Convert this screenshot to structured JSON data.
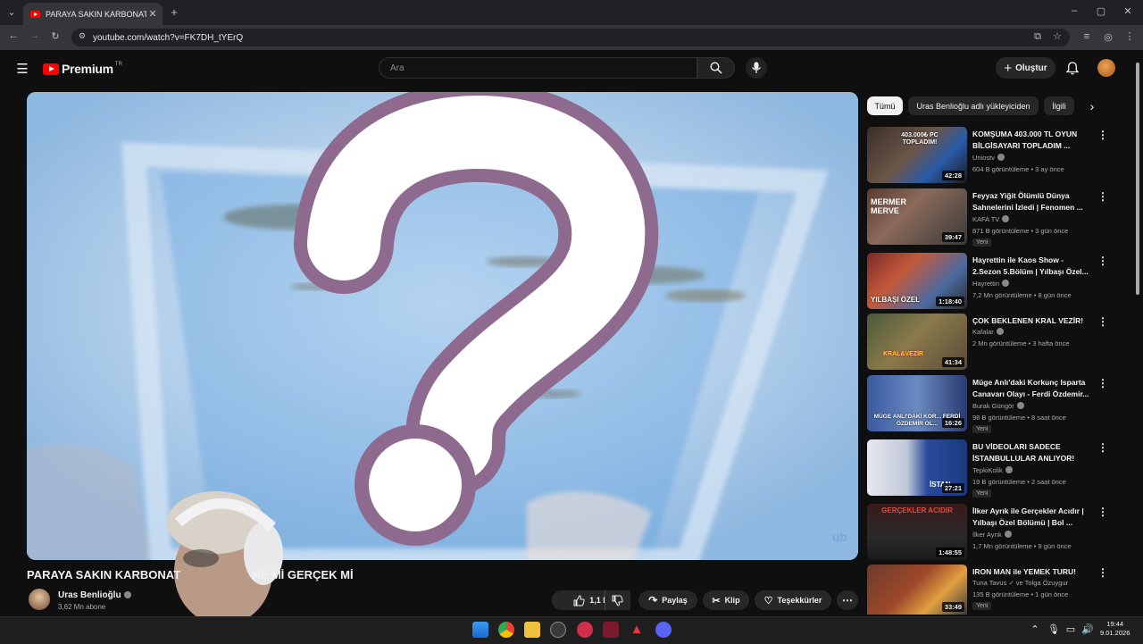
{
  "browser": {
    "tab_title": "PARAYA SAKIN KARBONAT DÖ...",
    "tab_close": "✕",
    "new_tab": "+",
    "url": "youtube.com/watch?v=FK7DH_tYErQ"
  },
  "header": {
    "logo_text": "Premium",
    "logo_region": "TR",
    "search_placeholder": "Ara",
    "create_label": "Oluştur"
  },
  "video": {
    "title": "PARAYA SAKIN KARBONAT",
    "title_tail": "NE Mİ GERÇEK Mİ",
    "channel": "Uras Benlioğlu",
    "subscribers": "3,62 Mn abone",
    "likes": "1,1 B",
    "share_label": "Paylaş",
    "clip_label": "Klip",
    "thanks_label": "Teşekkürler",
    "watermark": "ub"
  },
  "chips": [
    "Tümü",
    "Uras Benlioğlu adlı yükleyiciden",
    "İlgili"
  ],
  "recommendations": [
    {
      "title": "KOMŞUMA 403.000 TL OYUN BİLGİSAYARI TOPLADIM ...",
      "channel": "Uniostv",
      "meta": "604 B görüntüleme • 3 ay önce",
      "duration": "42:28",
      "badge": ""
    },
    {
      "title": "Feyyaz Yiğit Ölümlü Dünya Sahnelerini İzledi | Fenomen ...",
      "channel": "KAFA TV",
      "meta": "871 B görüntüleme • 3 gün önce",
      "duration": "39:47",
      "badge": "Yeni"
    },
    {
      "title": "Hayrettin ile Kaos Show - 2.Sezon 5.Bölüm | Yılbaşı Özel...",
      "channel": "Hayrettin",
      "meta": "7,2 Mn görüntüleme • 8 gün önce",
      "duration": "1:18:40",
      "badge": ""
    },
    {
      "title": "ÇOK BEKLENEN KRAL VEZİR!",
      "channel": "Kafalar",
      "meta": "2 Mn görüntüleme • 3 hafta önce",
      "duration": "41:34",
      "badge": ""
    },
    {
      "title": "Müge Anlı'daki Korkunç Isparta Canavarı Olayı - Ferdi Özdemir...",
      "channel": "Burak Güngör",
      "meta": "98 B görüntüleme • 8 saat önce",
      "duration": "16:26",
      "badge": "Yeni"
    },
    {
      "title": "BU VİDEOLARI SADECE İSTANBULLULAR ANLIYOR!",
      "channel": "TepkiKolik",
      "meta": "19 B görüntüleme • 2 saat önce",
      "duration": "27:21",
      "badge": "Yeni"
    },
    {
      "title": "İlker Ayrık ile Gerçekler Acıdır | Yılbaşı Özel Bölümü | Bol ...",
      "channel": "İlker Ayrık",
      "meta": "1,7 Mn görüntüleme • 9 gün önce",
      "duration": "1:48:55",
      "badge": ""
    },
    {
      "title": "IRON MAN ile YEMEK TURU!",
      "channel": "Tuna Tavus ✓ ve Tolga Özuygur",
      "meta": "135 B görüntüleme • 1 gün önce",
      "duration": "33:49",
      "badge": "Yeni"
    }
  ],
  "thumb_captions": [
    "403.000₺ PC TOPLADIM!",
    "MERMER MERVE",
    "YILBAŞI ÖZEL",
    "KRAL&VEZİR",
    "MÜGE ANLI'DAKİ KOR... FERDİ ÖZDEMİR OL...",
    "İSTAN",
    "GERÇEKLER ACIDIR",
    ""
  ],
  "taskbar": {
    "time": "19:44",
    "date": "9.01.2026"
  },
  "colors": {
    "background": "#0f0f0f",
    "accent_red": "#ff0000",
    "chip_active": "#f1f1f1",
    "pill": "#272727"
  }
}
